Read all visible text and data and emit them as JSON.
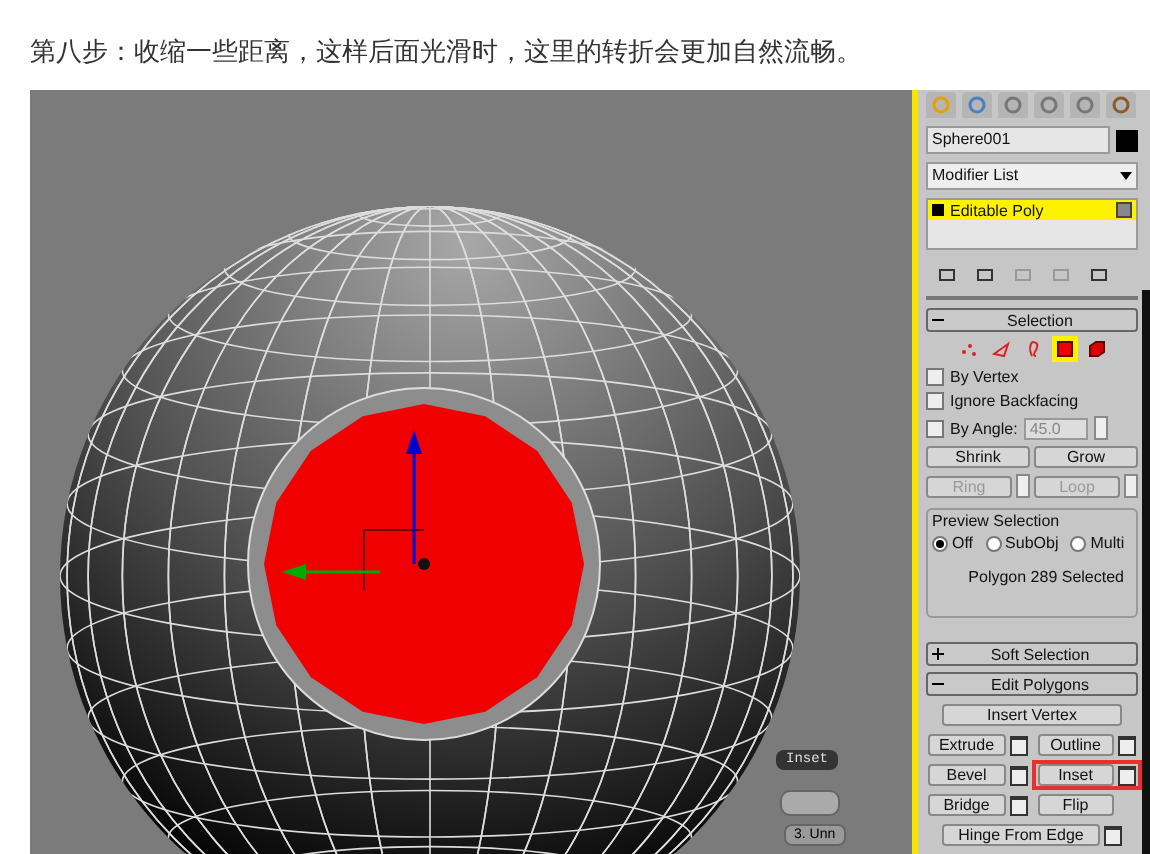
{
  "caption": "第八步：收缩一些距离，这样后面光滑时，这里的转折会更加自然流畅。",
  "viewport": {
    "active": true,
    "caddy_label": "Inset",
    "viewport_label": "3. Unn"
  },
  "panel": {
    "object_name": "Sphere001",
    "modifier_list": "Modifier List",
    "stack": [
      {
        "label": "Editable Poly",
        "selected": true
      }
    ],
    "selection": {
      "title": "Selection",
      "expanded": true,
      "levels": [
        {
          "kind": "vertex",
          "selected": false
        },
        {
          "kind": "edge",
          "selected": false
        },
        {
          "kind": "border",
          "selected": false
        },
        {
          "kind": "polygon",
          "selected": true
        },
        {
          "kind": "element",
          "selected": false
        }
      ],
      "checkboxes": [
        {
          "label": "By Vertex",
          "checked": false
        },
        {
          "label": "Ignore Backfacing",
          "checked": false
        },
        {
          "label": "By Angle:",
          "checked": false,
          "value": "45.0"
        }
      ],
      "buttons": [
        {
          "label": "Shrink",
          "disabled": false,
          "spinner": false
        },
        {
          "label": "Grow",
          "disabled": false,
          "spinner": false
        },
        {
          "label": "Ring",
          "disabled": true,
          "spinner": true
        },
        {
          "label": "Loop",
          "disabled": true,
          "spinner": true
        }
      ],
      "preview": {
        "title": "Preview Selection",
        "options": [
          {
            "label": "Off",
            "selected": true
          },
          {
            "label": "SubObj",
            "selected": false
          },
          {
            "label": "Multi",
            "selected": false
          }
        ]
      },
      "status": "Polygon 289 Selected"
    },
    "rollouts": [
      {
        "title": "Soft Selection",
        "expanded": false
      },
      {
        "title": "Edit Polygons",
        "expanded": true
      }
    ],
    "edit_polygons": [
      {
        "label": "Insert Vertex",
        "kind": "wide",
        "settings": false,
        "highlighted": false
      },
      {
        "label": "Extrude",
        "kind": "half",
        "settings": true,
        "highlighted": false
      },
      {
        "label": "Outline",
        "kind": "half",
        "settings": true,
        "highlighted": false
      },
      {
        "label": "Bevel",
        "kind": "half",
        "settings": true,
        "highlighted": false
      },
      {
        "label": "Inset",
        "kind": "half",
        "settings": true,
        "highlighted": true
      },
      {
        "label": "Bridge",
        "kind": "half",
        "settings": true,
        "highlighted": false
      },
      {
        "label": "Flip",
        "kind": "half",
        "settings": false,
        "highlighted": false
      },
      {
        "label": "Hinge From Edge",
        "kind": "wide",
        "settings": true,
        "highlighted": false
      }
    ]
  }
}
